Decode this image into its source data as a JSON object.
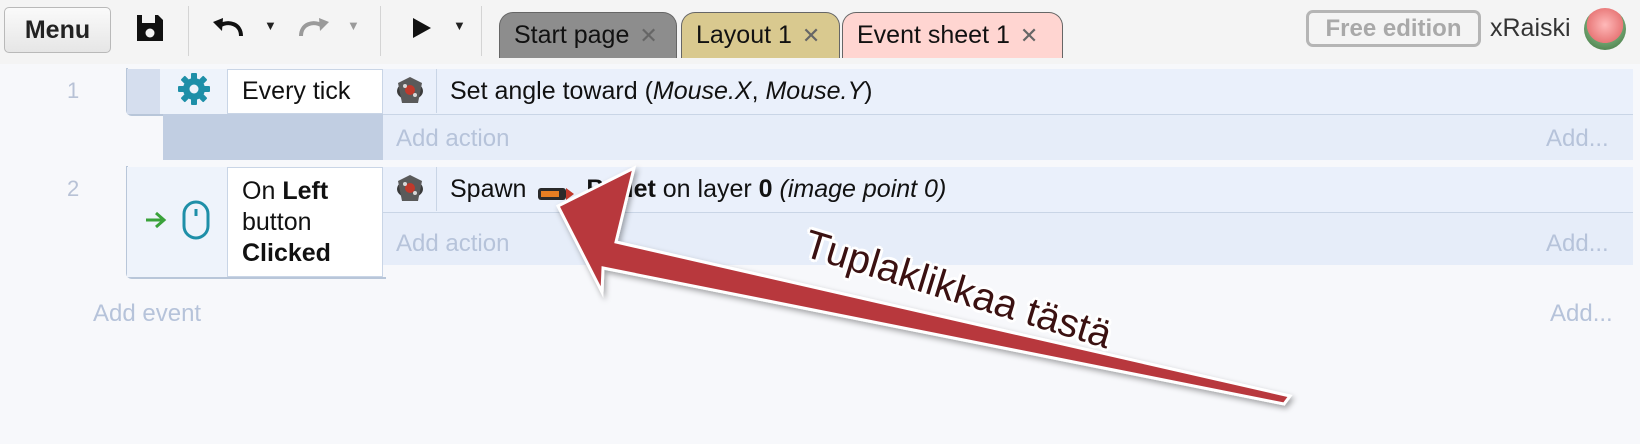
{
  "toolbar": {
    "menu_label": "Menu",
    "icons": [
      "save-icon",
      "undo-icon",
      "redo-icon",
      "play-icon"
    ]
  },
  "tabs": [
    {
      "label": "Start page",
      "color": "#8d8d8d"
    },
    {
      "label": "Layout 1",
      "color": "#d9c98f"
    },
    {
      "label": "Event sheet 1",
      "color": "#ffd5d1",
      "active": true
    }
  ],
  "account": {
    "edition": "Free edition",
    "username": "xRaiski"
  },
  "events": [
    {
      "number": "1",
      "condition": {
        "icon": "gear-icon",
        "text": "Every tick"
      },
      "action": {
        "object_icon": "sprite-player-icon",
        "prefix": "Set angle toward (",
        "arg1": "Mouse.X",
        "sep": ", ",
        "arg2": "Mouse.Y",
        "suffix": ")"
      },
      "add_action": "Add action",
      "add_more": "Add..."
    },
    {
      "number": "2",
      "condition": {
        "icon": "mouse-icon",
        "trigger_icon": "trigger-arrow-icon",
        "on": "On",
        "button": "Left",
        "line2": "button",
        "clicked": "Clicked"
      },
      "action": {
        "object_icon": "sprite-player-icon",
        "spawn": "Spawn",
        "spawn_icon": "bullet-sprite-icon",
        "object": "Bullet",
        "mid": "on layer",
        "layer": "0",
        "point": "(image point 0)"
      },
      "add_action": "Add action",
      "add_more": "Add..."
    }
  ],
  "add_event": "Add event",
  "add_event_more": "Add...",
  "annotation": {
    "text": "Tuplaklikkaa tästä",
    "arrow_color": "#b8383e"
  }
}
